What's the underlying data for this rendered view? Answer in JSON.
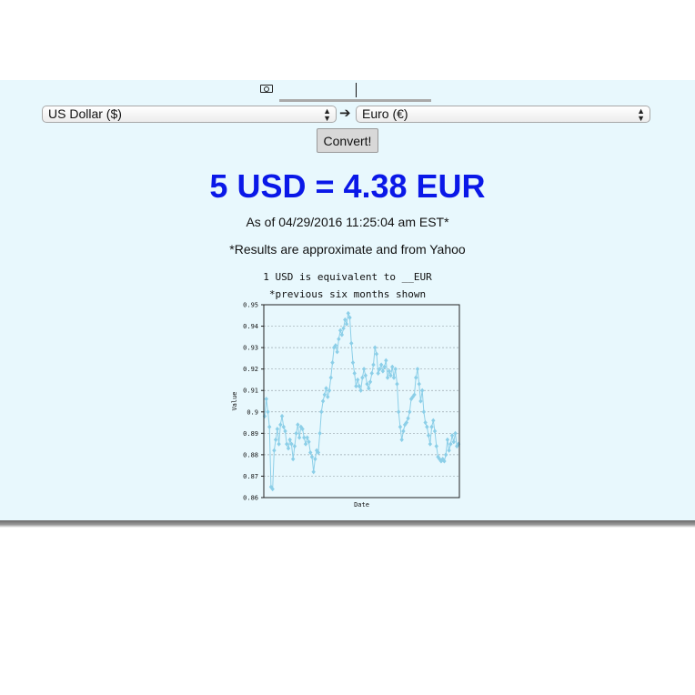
{
  "converter": {
    "amount_value": "",
    "from_currency": "US Dollar ($)",
    "to_currency": "Euro (€)",
    "convert_label": "Convert!",
    "result": "5 USD = 4.38 EUR",
    "as_of": "As of 04/29/2016 11:25:04 am EST*",
    "note": "*Results are approximate and from Yahoo"
  },
  "icons": {
    "amount": "money-icon",
    "swap": "right-arrow-icon",
    "select_arrows": "up-down-arrows-icon"
  },
  "colors": {
    "panel_bg": "#e8f8fd",
    "result_text": "#0a18e8",
    "series": "#8ccfe8"
  },
  "chart_data": {
    "type": "line",
    "title": "1 USD is equivalent to __EUR",
    "subtitle": "*previous six months shown",
    "xlabel": "Date",
    "ylabel": "Value",
    "ylim": [
      0.86,
      0.95
    ],
    "yticks": [
      0.86,
      0.87,
      0.88,
      0.89,
      0.9,
      0.91,
      0.92,
      0.93,
      0.94,
      0.95
    ],
    "grid": true,
    "series": [
      {
        "values": [
          0.898,
          0.906,
          0.9,
          0.893,
          0.865,
          0.864,
          0.882,
          0.887,
          0.892,
          0.885,
          0.894,
          0.898,
          0.893,
          0.891,
          0.885,
          0.883,
          0.887,
          0.885,
          0.878,
          0.884,
          0.89,
          0.894,
          0.888,
          0.893,
          0.892,
          0.888,
          0.885,
          0.888,
          0.886,
          0.881,
          0.879,
          0.872,
          0.878,
          0.882,
          0.881,
          0.89,
          0.9,
          0.905,
          0.908,
          0.911,
          0.907,
          0.91,
          0.916,
          0.923,
          0.93,
          0.931,
          0.928,
          0.934,
          0.938,
          0.936,
          0.939,
          0.943,
          0.941,
          0.946,
          0.944,
          0.932,
          0.923,
          0.918,
          0.912,
          0.915,
          0.912,
          0.91,
          0.916,
          0.92,
          0.917,
          0.913,
          0.911,
          0.914,
          0.918,
          0.922,
          0.93,
          0.927,
          0.918,
          0.92,
          0.922,
          0.919,
          0.921,
          0.924,
          0.916,
          0.919,
          0.917,
          0.921,
          0.916,
          0.92,
          0.913,
          0.9,
          0.893,
          0.887,
          0.891,
          0.894,
          0.895,
          0.897,
          0.9,
          0.906,
          0.907,
          0.908,
          0.916,
          0.92,
          0.913,
          0.905,
          0.91,
          0.9,
          0.895,
          0.893,
          0.889,
          0.885,
          0.893,
          0.896,
          0.891,
          0.884,
          0.879,
          0.878,
          0.877,
          0.878,
          0.877,
          0.88,
          0.887,
          0.882,
          0.885,
          0.889,
          0.886,
          0.89,
          0.884,
          0.885
        ]
      }
    ]
  }
}
